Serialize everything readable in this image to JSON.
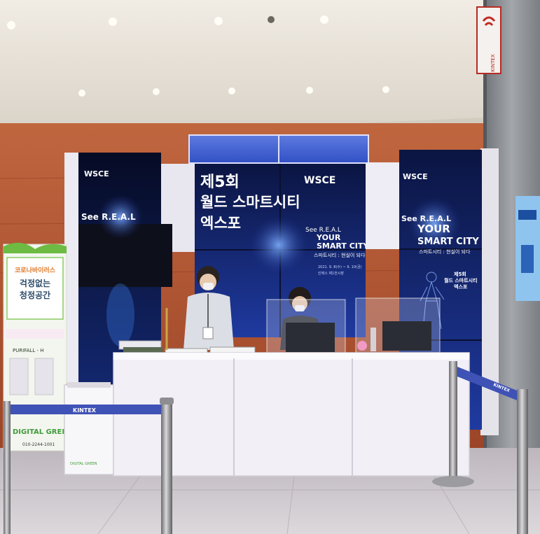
{
  "photo": {
    "subject": "exhibition-booth",
    "colors": {
      "wall": "#b85a36",
      "ceiling": "#e4ddd2",
      "screen_dark": "#0c1a4a",
      "screen_blue": "#2440a8",
      "counter": "#f3f0f7",
      "floor": "#cfcbcf",
      "pillar": "#8d8f93",
      "rope": "#3f4fb0"
    }
  },
  "screens": {
    "left_logo": "WSCE",
    "left_tag": "See R.E.A.L",
    "center_title_line1": "제5회",
    "center_title_line2": "월드 스마트시티",
    "center_title_line3": "엑스포",
    "center_logo": "WSCE",
    "center_see": "See R.E.A.L",
    "center_your": "YOUR",
    "center_smartcity": "SMART CITY",
    "center_korean_tag": "스마트시티 : 현실이 되다",
    "center_date": "2021. 9. 8(수) ~ 9. 10(금)",
    "center_venue": "킨텍스 제1전시장",
    "right_logo": "WSCE",
    "right_see": "See R.E.A.L",
    "right_your": "YOUR",
    "right_smartcity": "SMART CITY",
    "right_korean_tag": "스마트시티 : 현실이 되다",
    "right_ed1": "제5회",
    "right_ed2": "월드 스마트시티",
    "right_ed3": "엑스포"
  },
  "side_panel": {
    "heading": "코로나바이러스",
    "title": "걱정없는",
    "subtitle": "청정공간",
    "product": "PURIFALL - H",
    "brand": "DIGITAL GREEN",
    "phone": "010-2244-1001"
  },
  "signs": {
    "pillar_sign": "KINTEX",
    "rope_left": "KINTEX",
    "rope_right": "KINTEX"
  },
  "purifier": {
    "brand": "DIGITAL GREEN"
  }
}
